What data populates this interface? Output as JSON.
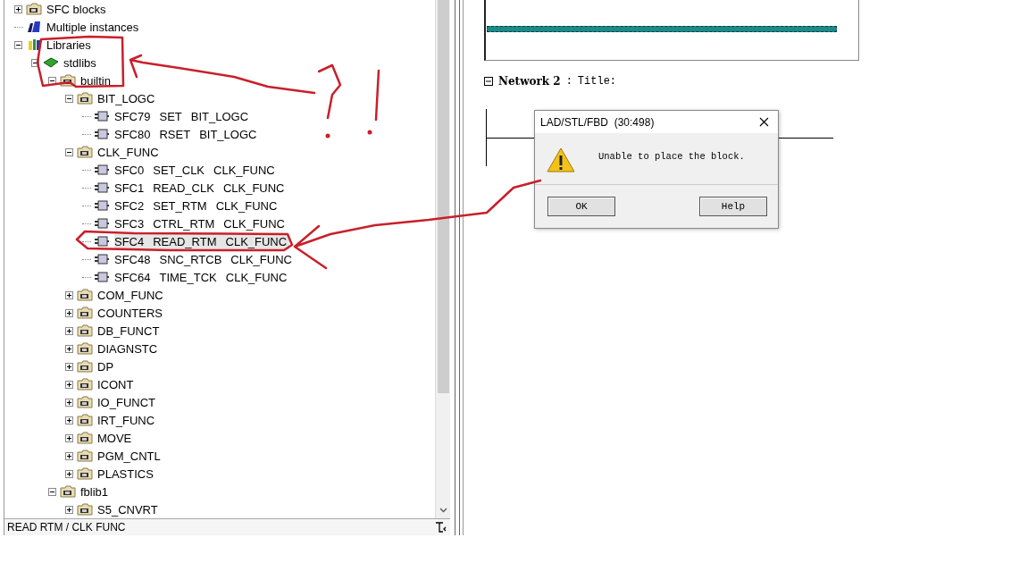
{
  "tree": [
    {
      "kind": "block-folder",
      "label": "SFC blocks",
      "expanded": false
    },
    {
      "kind": "instances",
      "label": "Multiple instances"
    },
    {
      "kind": "library",
      "label": "Libraries",
      "expanded": true,
      "children": [
        {
          "kind": "book",
          "label": "stdlibs",
          "expanded": true,
          "children": [
            {
              "kind": "block-folder",
              "label": "builtin",
              "expanded": true,
              "children": [
                {
                  "kind": "block-folder",
                  "label": "BIT_LOGC",
                  "expanded": true,
                  "children": [
                    {
                      "kind": "block",
                      "number": "SFC79",
                      "name": "SET",
                      "family": "BIT_LOGC",
                      "selected": false
                    },
                    {
                      "kind": "block",
                      "number": "SFC80",
                      "name": "RSET",
                      "family": "BIT_LOGC",
                      "selected": false
                    }
                  ]
                },
                {
                  "kind": "block-folder",
                  "label": "CLK_FUNC",
                  "expanded": true,
                  "children": [
                    {
                      "kind": "block",
                      "number": "SFC0",
                      "name": "SET_CLK",
                      "family": "CLK_FUNC",
                      "selected": false
                    },
                    {
                      "kind": "block",
                      "number": "SFC1",
                      "name": "READ_CLK",
                      "family": "CLK_FUNC",
                      "selected": false
                    },
                    {
                      "kind": "block",
                      "number": "SFC2",
                      "name": "SET_RTM",
                      "family": "CLK_FUNC",
                      "selected": false
                    },
                    {
                      "kind": "block",
                      "number": "SFC3",
                      "name": "CTRL_RTM",
                      "family": "CLK_FUNC",
                      "selected": false
                    },
                    {
                      "kind": "block",
                      "number": "SFC4",
                      "name": "READ_RTM",
                      "family": "CLK_FUNC",
                      "selected": true
                    },
                    {
                      "kind": "block",
                      "number": "SFC48",
                      "name": "SNC_RTCB",
                      "family": "CLK_FUNC",
                      "selected": false
                    },
                    {
                      "kind": "block",
                      "number": "SFC64",
                      "name": "TIME_TCK",
                      "family": "CLK_FUNC",
                      "selected": false
                    }
                  ]
                },
                {
                  "kind": "block-folder",
                  "label": "COM_FUNC",
                  "expanded": false
                },
                {
                  "kind": "block-folder",
                  "label": "COUNTERS",
                  "expanded": false
                },
                {
                  "kind": "block-folder",
                  "label": "DB_FUNCT",
                  "expanded": false
                },
                {
                  "kind": "block-folder",
                  "label": "DIAGNSTC",
                  "expanded": false
                },
                {
                  "kind": "block-folder",
                  "label": "DP",
                  "expanded": false
                },
                {
                  "kind": "block-folder",
                  "label": "ICONT",
                  "expanded": false
                },
                {
                  "kind": "block-folder",
                  "label": "IO_FUNCT",
                  "expanded": false
                },
                {
                  "kind": "block-folder",
                  "label": "IRT_FUNC",
                  "expanded": false
                },
                {
                  "kind": "block-folder",
                  "label": "MOVE",
                  "expanded": false
                },
                {
                  "kind": "block-folder",
                  "label": "PGM_CNTL",
                  "expanded": false
                },
                {
                  "kind": "block-folder",
                  "label": "PLASTICS",
                  "expanded": false
                }
              ]
            },
            {
              "kind": "block-folder",
              "label": "fblib1",
              "expanded": true,
              "children": [
                {
                  "kind": "block-folder",
                  "label": "S5_CNVRT",
                  "expanded": false
                }
              ]
            }
          ]
        }
      ]
    }
  ],
  "status_bar": "READ RTM / CLK FUNC",
  "network": {
    "expanded": true,
    "heading": "Network 2",
    "separator": ":",
    "title": "Title:"
  },
  "dialog": {
    "title": "LAD/STL/FBD  (30:498)",
    "message": "Unable to place the block.",
    "buttons": [
      "OK",
      "Help"
    ]
  }
}
